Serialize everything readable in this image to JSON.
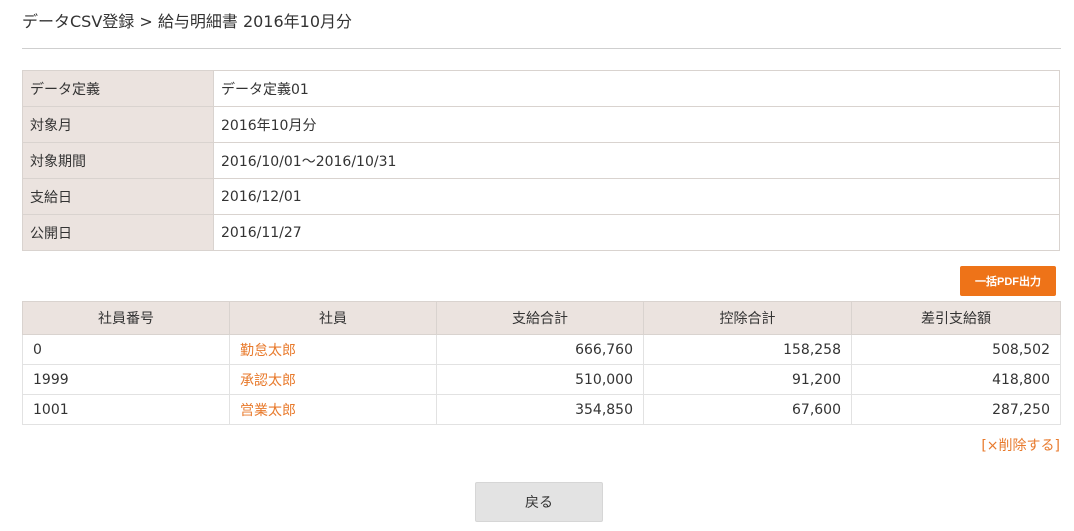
{
  "breadcrumb": {
    "title": "データCSV登録 > 給与明細書 2016年10月分"
  },
  "info": {
    "rows": [
      {
        "label": "データ定義",
        "value": "データ定義01"
      },
      {
        "label": "対象月",
        "value": "2016年10月分"
      },
      {
        "label": "対象期間",
        "value": "2016/10/01〜2016/10/31"
      },
      {
        "label": "支給日",
        "value": "2016/12/01"
      },
      {
        "label": "公開日",
        "value": "2016/11/27"
      }
    ]
  },
  "actions": {
    "pdf_export": "一括PDF出力",
    "delete": "[×削除する]",
    "back": "戻る"
  },
  "employees": {
    "headers": [
      "社員番号",
      "社員",
      "支給合計",
      "控除合計",
      "差引支給額"
    ],
    "rows": [
      {
        "id": "0",
        "name": "勤怠太郎",
        "pay_total": "666,760",
        "deduction_total": "158,258",
        "net_pay": "508,502"
      },
      {
        "id": "1999",
        "name": "承認太郎",
        "pay_total": "510,000",
        "deduction_total": "91,200",
        "net_pay": "418,800"
      },
      {
        "id": "1001",
        "name": "営業太郎",
        "pay_total": "354,850",
        "deduction_total": "67,600",
        "net_pay": "287,250"
      }
    ]
  },
  "colors": {
    "accent": "#ee7318",
    "link": "#e87a2c",
    "header_bg": "#ebe3df"
  }
}
